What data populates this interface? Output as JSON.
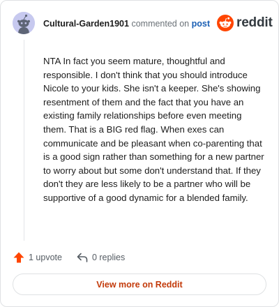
{
  "comment": {
    "author": "Cultural-Garden1901",
    "action_text": "commented on",
    "post_link": "post",
    "body": "NTA In fact you seem mature, thoughtful and responsible. I don't think that you should introduce Nicole to your kids. She isn't a keeper. She's showing resentment of them and the fact that you have an existing family relationships before even meeting them. That is a BIG red flag. When exes can communicate and be pleasant when co-parenting that is a good sign rather than something for a new partner to worry about but some don't understand that. If they don't they are less likely to be a partner who will be supportive of a good dynamic for a blended family."
  },
  "brand": {
    "wordmark": "reddit",
    "color": "#ff4500"
  },
  "actions": {
    "upvotes": "1 upvote",
    "replies": "0 replies"
  },
  "footer": {
    "view_more_label": "View more on Reddit"
  },
  "colors": {
    "accent": "#c33a0a",
    "upvote": "#ff4500",
    "link": "#1a5fb4",
    "avatar_bg": "#c7c9ef"
  }
}
